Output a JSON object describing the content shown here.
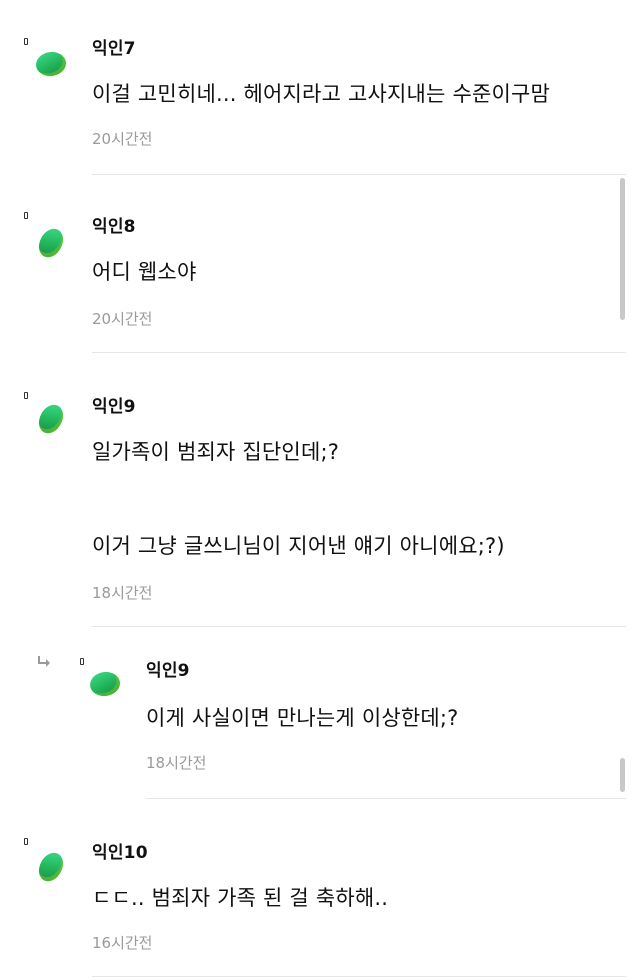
{
  "comments": [
    {
      "nickname": "익인7",
      "lines": [
        "이걸 고민히네... 헤어지라고 고사지내는 수준이구맘"
      ],
      "time": "20시간전"
    },
    {
      "nickname": "익인8",
      "lines": [
        "어디 웹소야"
      ],
      "time": "20시간전"
    },
    {
      "nickname": "익인9",
      "lines": [
        "일가족이 범죄자 집단인데;?",
        "이거 그냥 글쓰니님이 지어낸 얘기 아니에요;?)"
      ],
      "time": "18시간전"
    },
    {
      "nickname": "익인9",
      "is_reply": true,
      "lines": [
        "이게 사실이면 만나는게 이상한데;?"
      ],
      "time": "18시간전"
    },
    {
      "nickname": "익인10",
      "lines": [
        "ㄷㄷ.. 범죄자 가족 된 걸 축하해.."
      ],
      "time": "16시간전"
    }
  ],
  "icons": {
    "avatar": "green-avatar-icon",
    "reply": "reply-arrow-icon",
    "marker": "small-marker-icon"
  },
  "colors": {
    "avatar_green": "#22b35b",
    "time_gray": "#9a9a9a",
    "divider": "#e6e6e6"
  }
}
